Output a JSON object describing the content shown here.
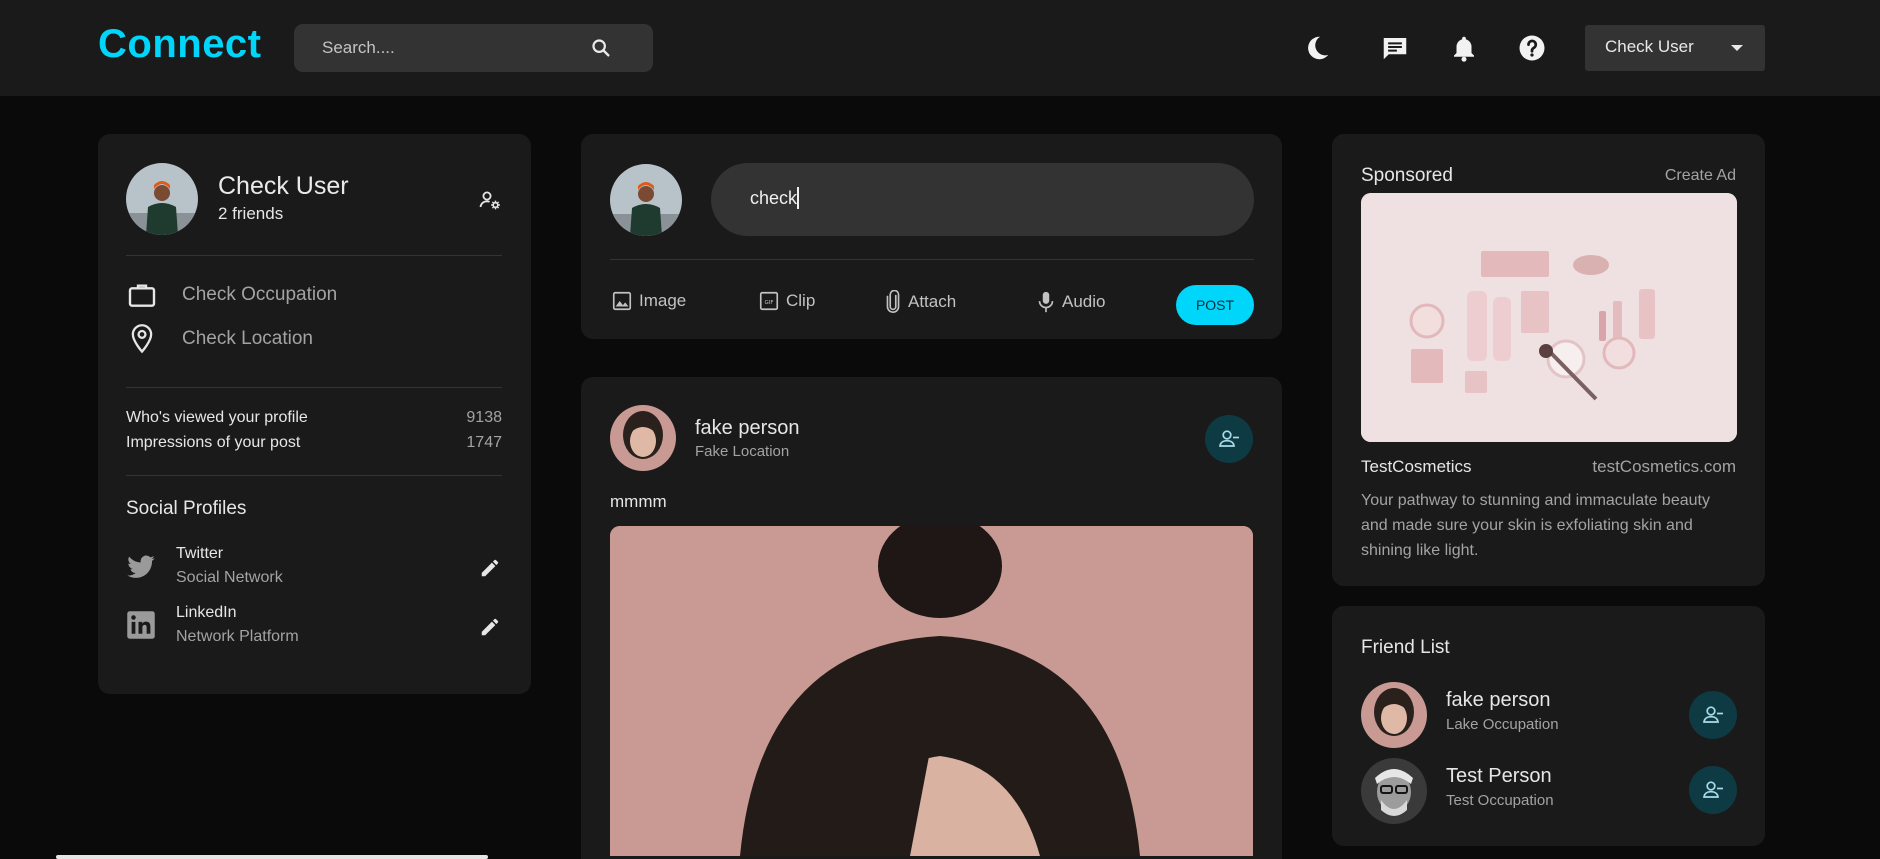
{
  "navbar": {
    "logo": "Connect",
    "search_placeholder": "Search....",
    "user_select": "Check User"
  },
  "profile": {
    "name": "Check User",
    "friends": "2 friends",
    "occupation": "Check Occupation",
    "location": "Check Location",
    "stats": [
      {
        "label": "Who's viewed your profile",
        "value": "9138"
      },
      {
        "label": "Impressions of your post",
        "value": "1747"
      }
    ],
    "social_title": "Social Profiles",
    "social": [
      {
        "name": "Twitter",
        "sub": "Social Network"
      },
      {
        "name": "LinkedIn",
        "sub": "Network Platform"
      }
    ]
  },
  "composer": {
    "input_value": "check",
    "actions": [
      "Image",
      "Clip",
      "Attach",
      "Audio"
    ],
    "post_label": "POST"
  },
  "post": {
    "author": "fake person",
    "location": "Fake Location",
    "text": "mmmm"
  },
  "sponsored": {
    "title": "Sponsored",
    "create_ad": "Create Ad",
    "brand": "TestCosmetics",
    "site": "testCosmetics.com",
    "description": "Your pathway to stunning and immaculate beauty and made sure your skin is exfoliating skin and shining like light."
  },
  "friends": {
    "title": "Friend List",
    "items": [
      {
        "name": "fake person",
        "occupation": "Lake Occupation"
      },
      {
        "name": "Test Person",
        "occupation": "Test Occupation"
      }
    ]
  },
  "colors": {
    "accent": "#00d5fa",
    "card": "#1a1a1a",
    "background": "#0a0a0a",
    "input": "#333333",
    "round_button": "#0e3a44"
  },
  "icons": [
    "search-icon",
    "moon-icon",
    "message-icon",
    "bell-icon",
    "help-icon",
    "manage-account-icon",
    "briefcase-icon",
    "location-pin-icon",
    "twitter-icon",
    "linkedin-icon",
    "edit-icon",
    "image-icon",
    "gif-icon",
    "attach-icon",
    "microphone-icon",
    "remove-friend-icon"
  ]
}
